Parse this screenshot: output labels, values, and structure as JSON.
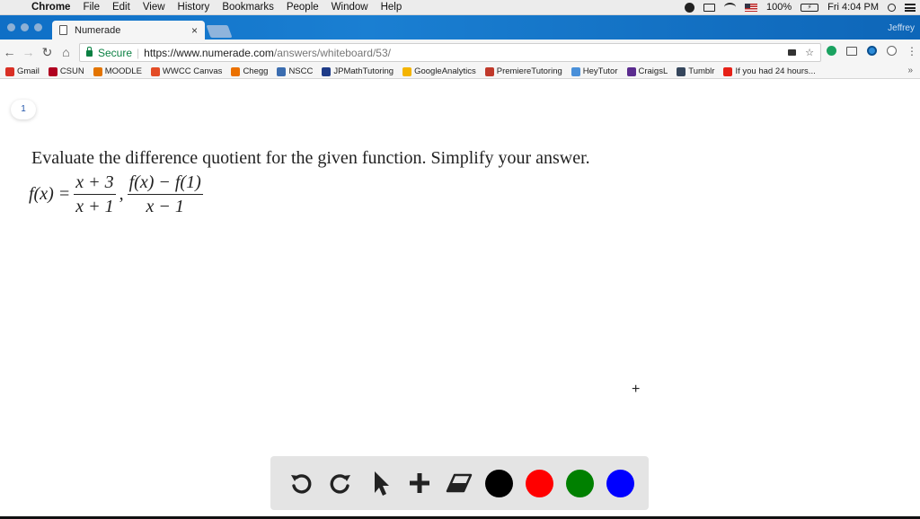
{
  "menubar": {
    "app": "Chrome",
    "items": [
      "File",
      "Edit",
      "View",
      "History",
      "Bookmarks",
      "People",
      "Window",
      "Help"
    ],
    "battery": "100%",
    "battery_label": "⚡",
    "clock": "Fri 4:04 PM"
  },
  "tab": {
    "title": "Numerade",
    "close": "×"
  },
  "profile": "Jeffrey",
  "omnibox": {
    "secure_label": "Secure",
    "url_scheme_host": "https://www.numerade.com",
    "url_path": "/answers/whiteboard/53/"
  },
  "bookmarks": [
    {
      "label": "Gmail",
      "color": "#d93025"
    },
    {
      "label": "CSUN",
      "color": "#b00020"
    },
    {
      "label": "MOODLE",
      "color": "#e37400"
    },
    {
      "label": "WWCC Canvas",
      "color": "#e34c26"
    },
    {
      "label": "Chegg",
      "color": "#eb7100"
    },
    {
      "label": "NSCC",
      "color": "#3b6db0"
    },
    {
      "label": "JPMathTutoring",
      "color": "#1f3c88"
    },
    {
      "label": "GoogleAnalytics",
      "color": "#f4b400"
    },
    {
      "label": "PremiereTutoring",
      "color": "#c0392b"
    },
    {
      "label": "HeyTutor",
      "color": "#4a90d9"
    },
    {
      "label": "CraigsL",
      "color": "#5b2c8f"
    },
    {
      "label": "Tumblr",
      "color": "#35465c"
    },
    {
      "label": "If you had 24 hours...",
      "color": "#e62117"
    }
  ],
  "bookmarks_more": "»",
  "page": {
    "page_number": "1",
    "question": "Evaluate the difference quotient for the given function. Simplify your answer.",
    "math": {
      "lhs": "f(x) =",
      "frac1_num": "x + 3",
      "frac1_den": "x + 1",
      "comma": ",",
      "frac2_num": "f(x) − f(1)",
      "frac2_den": "x − 1"
    },
    "cursor": "+"
  },
  "whiteboard_toolbar": {
    "colors": [
      "#000000",
      "#ff0000",
      "#008000",
      "#0000ff"
    ]
  }
}
